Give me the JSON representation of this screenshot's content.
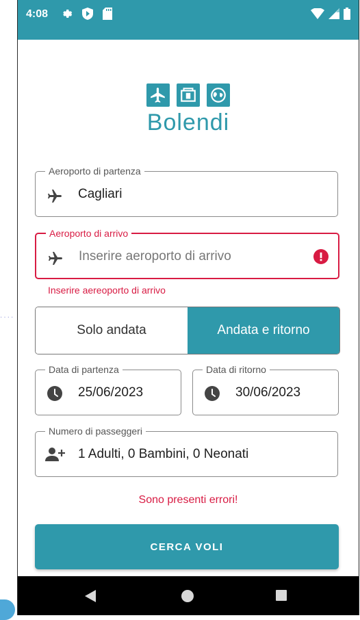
{
  "status_bar": {
    "time": "4:08",
    "icons_left": [
      "gear-icon",
      "play-protect-icon",
      "sd-card-icon"
    ],
    "icons_right": [
      "wifi-icon",
      "signal-icon",
      "battery-icon"
    ]
  },
  "app": {
    "name": "Bolendi",
    "brand_color": "#2f99ab",
    "error_color": "#d81b43"
  },
  "departure_airport": {
    "label": "Aeroporto di partenza",
    "value": "Cagliari"
  },
  "arrival_airport": {
    "label": "Aeroporto di arrivo",
    "placeholder": "Inserire aeroporto di arrivo",
    "error": "Inserire aereoporto di arrivo"
  },
  "trip_type": {
    "options": [
      "Solo andata",
      "Andata e ritorno"
    ],
    "selected": "Andata e ritorno"
  },
  "departure_date": {
    "label": "Data di partenza",
    "value": "25/06/2023"
  },
  "return_date": {
    "label": "Data di ritorno",
    "value": "30/06/2023"
  },
  "passengers": {
    "label": "Numero di passeggeri",
    "value": "1 Adulti, 0 Bambini, 0 Neonati"
  },
  "form_error": "Sono presenti errori!",
  "search_button": "CERCA VOLI"
}
